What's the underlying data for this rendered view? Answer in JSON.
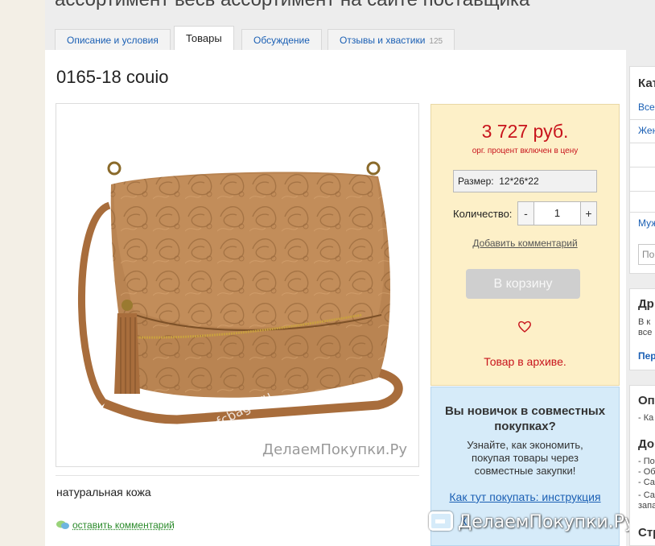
{
  "header": {
    "top_title": "ассортимент весь ассортимент на сайте поставщика"
  },
  "tabs": [
    {
      "label": "Описание и условия",
      "active": false
    },
    {
      "label": "Товары",
      "active": true
    },
    {
      "label": "Обсуждение",
      "active": false
    },
    {
      "label": "Отзывы и хвастики",
      "count": "125",
      "active": false
    }
  ],
  "product": {
    "title": "0165-18 couio",
    "description": "натуральная кожа",
    "comment_link": "оставить комментарий",
    "photo_watermark": "ДелаемПокупки.Ру",
    "photo_diagonal_watermark": "www.fcbags.ru"
  },
  "buy_panel": {
    "price": "3 727 руб.",
    "price_note": "орг. процент включен в цену",
    "size_label": "Размер:",
    "size_value": "12*26*22",
    "qty_label": "Количество:",
    "qty_minus": "-",
    "qty_value": "1",
    "qty_plus": "+",
    "add_comment": "Добавить комментарий",
    "cart_button": "В корзину",
    "favorite_icon": "heart-icon",
    "archive_text": "Товар в архиве."
  },
  "info_panel": {
    "title": "Вы новичок в совместных покупках?",
    "text": "Узнайте, как экономить, покупая товары через совместные закупки!",
    "link": "Как тут покупать: инструкция",
    "link2": "К"
  },
  "watermark": {
    "text": "ДелаемПокупки.Ру"
  },
  "sidebar": {
    "categories_heading": "Кат",
    "categories_all": "Все",
    "categories_women": "Жен",
    "categories_men": "Муж",
    "search_placeholder": "По",
    "friends_heading": "Др",
    "friends_text_1": "В к",
    "friends_text_2": "все",
    "friends_link": "Пер",
    "options_heading": "Оп",
    "options_text": "- Ка",
    "delivery_heading": "До",
    "delivery_lines": [
      "- По",
      "- Об",
      "- Са",
      "- Са",
      "запа"
    ],
    "bottom_heading": "Стр"
  },
  "colors": {
    "price_red": "#c8141c",
    "buy_panel_bg": "#fdf0c8",
    "info_panel_bg": "#d6ebf9",
    "link_blue": "#1a5fb4",
    "bag_tan": "#b07a48"
  }
}
